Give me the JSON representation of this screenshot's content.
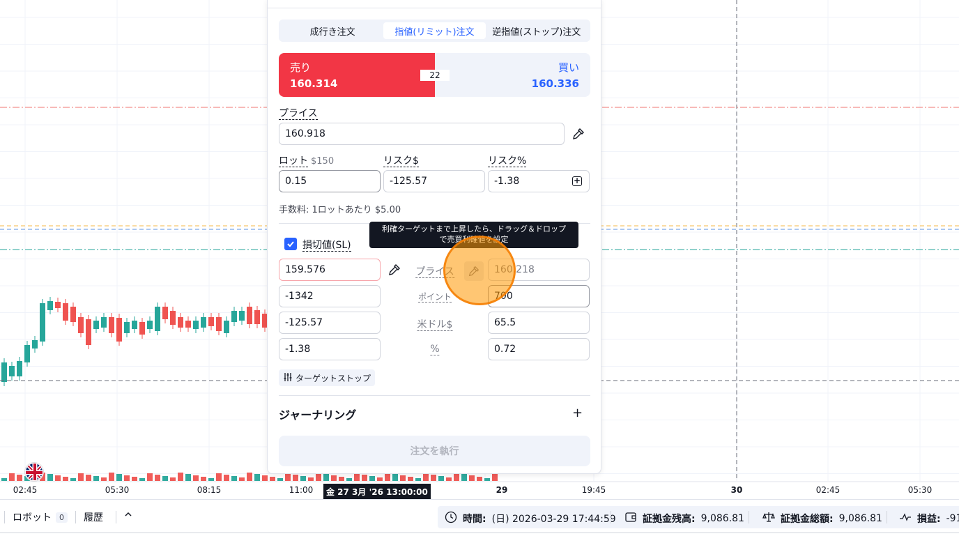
{
  "colors": {
    "bull": "#26a69a",
    "bear": "#ef5350",
    "sell": "#f23645",
    "accent": "#2962ff",
    "tp_line": "#26a69a",
    "sl_line": "#ef5350",
    "orange_line": "#f7c56a",
    "blue_line": "#7aa6e6"
  },
  "chart": {
    "time_axis": [
      "02:45",
      "05:30",
      "08:15",
      "11:00",
      "29",
      "19:45",
      "30",
      "02:45",
      "05:30"
    ],
    "crosshair_time": "金 27 3月 '26 13:00:00"
  },
  "order_panel": {
    "tabs": [
      "成行き注文",
      "指値(リミット)注文",
      "逆指値(ストップ)注文"
    ],
    "active_tab": "指値(リミット)注文",
    "sell": {
      "label": "売り",
      "price": "160.314"
    },
    "buy": {
      "label": "買い",
      "price": "160.336"
    },
    "spread": "22",
    "price": {
      "label": "プライス",
      "value": "160.918"
    },
    "lot": {
      "label": "ロット",
      "sub": "$150",
      "value": "0.15"
    },
    "risk_usd": {
      "label": "リスク$",
      "value": "-125.57"
    },
    "risk_pct": {
      "label": "リスク%",
      "value": "-1.38"
    },
    "fee": "手数料: 1ロットあたり $5.00",
    "stop_loss": {
      "label": "損切値(SL)",
      "checked": true,
      "price": "159.576",
      "points": "-1342",
      "usd": "-125.57",
      "pct": "-1.38"
    },
    "mid_labels": {
      "price": "プライス",
      "points": "ポイント",
      "usd": "米ドル$",
      "pct": "%"
    },
    "take_profit": {
      "price": "160.​218",
      "points": "700",
      "usd": "65.5",
      "pct": "0.72"
    },
    "target_stop": "ターゲットストップ",
    "journal": "ジャーナリング",
    "execute": "注文を執行",
    "tooltip_line1": "利確ターゲットまで上昇したら、ドラッグ＆ドロップ",
    "tooltip_line2": "で売買利確値を設定"
  },
  "bottom_bar": {
    "robot": "ロボット",
    "robot_count": "0",
    "history": "履歴",
    "time_label": "時間:",
    "time_value": "(日) 2026-03-29 17:44:59",
    "balance_label": "証拠金残高:",
    "balance_value": "9,086.81",
    "equity_label": "証拠金総額:",
    "equity_value": "9,086.81",
    "pnl_label": "損益:",
    "pnl_value": "-91"
  }
}
